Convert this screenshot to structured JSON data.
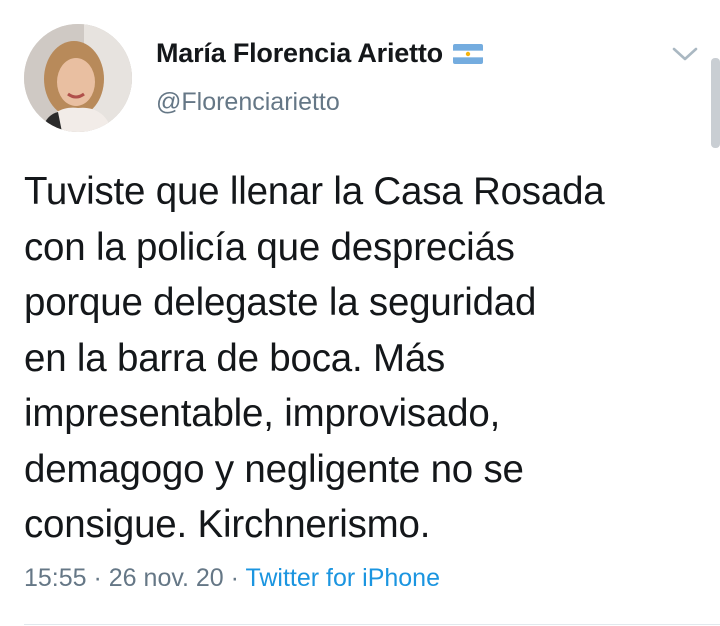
{
  "user": {
    "display_name": "María Florencia Arietto",
    "handle": "@Florenciarietto",
    "flag_icon": "argentina-flag-icon"
  },
  "tweet": {
    "lines": [
      "Tuviste que llenar la Casa Rosada",
      "con la policía que despreciás",
      "porque delegaste la seguridad",
      "en la barra de boca. Más",
      "impresentable, improvisado,",
      "demagogo y negligente no se",
      "consigue. Kirchnerismo."
    ]
  },
  "meta": {
    "time": "15:55",
    "sep1": " · ",
    "date": "26 nov. 20",
    "sep2": " · ",
    "source": "Twitter for iPhone"
  },
  "colors": {
    "text": "#14171a",
    "secondary": "#657786",
    "link": "#1b95e0"
  }
}
